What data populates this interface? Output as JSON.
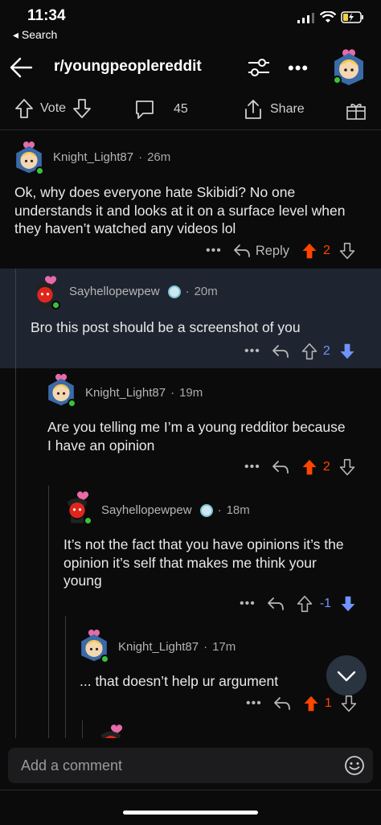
{
  "status": {
    "time": "11:34",
    "back_app": "◂ Search"
  },
  "nav": {
    "subreddit": "r/youngpeoplereddit"
  },
  "post_actions": {
    "vote_label": "Vote",
    "comment_count": "45",
    "share_label": "Share"
  },
  "comments": [
    {
      "author": "Knight_Light87",
      "age": "26m",
      "text": "Ok, why does everyone hate Skibidi? No one understands it and looks at it on a surface level when they haven’t watched any videos lol",
      "reply_label": "Reply",
      "score": "2",
      "vote_state": "up"
    },
    {
      "author": "Sayhellopewpew",
      "age": "20m",
      "text": "Bro this post should be a screenshot of you",
      "score": "2",
      "vote_state": "down"
    },
    {
      "author": "Knight_Light87",
      "age": "19m",
      "text": "Are you telling me I’m a young redditor because I have an opinion",
      "score": "2",
      "vote_state": "up"
    },
    {
      "author": "Sayhellopewpew",
      "age": "18m",
      "text": "It’s not the fact that you have opinions it’s the opinion it’s self that makes me think your young",
      "score": "-1",
      "vote_state": "down"
    },
    {
      "author": "Knight_Light87",
      "age": "17m",
      "text": "... that doesn’t help ur argument",
      "score": "1",
      "vote_state": "up"
    }
  ],
  "composer": {
    "placeholder": "Add a comment"
  },
  "colors": {
    "upvote": "#ff4500",
    "downvote": "#7193ff",
    "highlight_bg": "#1e2530"
  },
  "icons": [
    "back-arrow-icon",
    "filter-icon",
    "more-icon",
    "upvote-icon",
    "downvote-icon",
    "comment-icon",
    "share-icon",
    "award-icon",
    "reply-icon",
    "emoji-icon",
    "chevron-down-icon"
  ]
}
